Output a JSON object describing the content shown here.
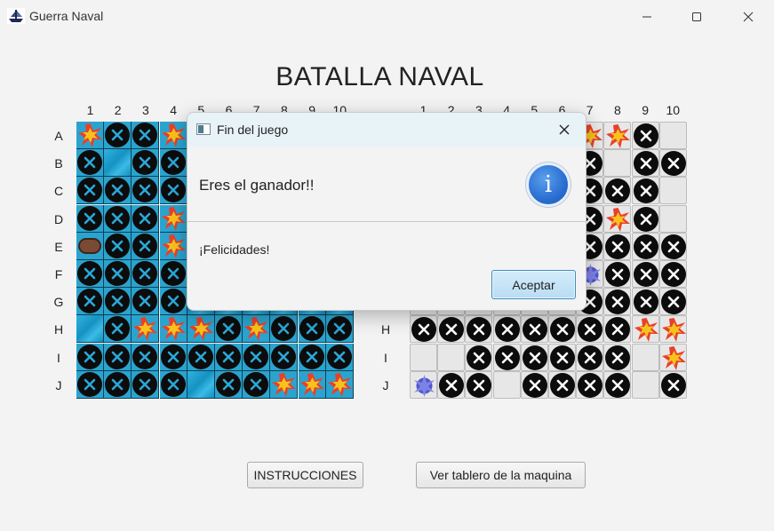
{
  "window": {
    "title": "Guerra Naval",
    "minimize_icon": "minimize-icon",
    "maximize_icon": "maximize-icon",
    "close_icon": "close-icon"
  },
  "main_title": "BATALLA NAVAL",
  "columns": [
    "1",
    "2",
    "3",
    "4",
    "5",
    "6",
    "7",
    "8",
    "9",
    "10"
  ],
  "rows": [
    "A",
    "B",
    "C",
    "D",
    "E",
    "F",
    "G",
    "H",
    "I",
    "J"
  ],
  "legend": {
    "W": "water",
    "M": "miss-marker",
    "H": "hit-explosion",
    "S": "ship-part",
    "E": "empty-cell",
    "B": "sunk-bomb"
  },
  "player_board": [
    "HMMHWWWWWW",
    "MWMMWWWWWW",
    "MMMMWWWWWW",
    "MMMHWWWWWW",
    "SMMHWWWWWW",
    "MMMMWWWWWW",
    "MMMMWWWWWW",
    "WMHHHMHMMM",
    "MMMMMMMMMM",
    "MMMMWMMHHH"
  ],
  "machine_board": [
    "EEEEEEHHME",
    "EEEEEEMEMM",
    "EEEEEEMMME",
    "EEEEEEMHME",
    "EEEEEEMMMM",
    "EEEEEEBMMM",
    "EEEEEEMMMM",
    "MMMMMMMMHH",
    "EEMMMMMMEH",
    "BMMEMMMMEM"
  ],
  "buttons": {
    "instructions": "INSTRUCCIONES",
    "view_machine": "Ver tablero de la maquina"
  },
  "dialog": {
    "title": "Fin del juego",
    "header": "Eres el ganador!!",
    "content": "¡Felicidades!",
    "ok": "Aceptar",
    "icon": "information-icon",
    "close_icon": "close-icon"
  },
  "colors": {
    "water": "#2aa4cf",
    "miss_circle": "#0c0c0c",
    "hit_fire": "#f2b51b",
    "dialog_button": "#b9dcf3"
  }
}
